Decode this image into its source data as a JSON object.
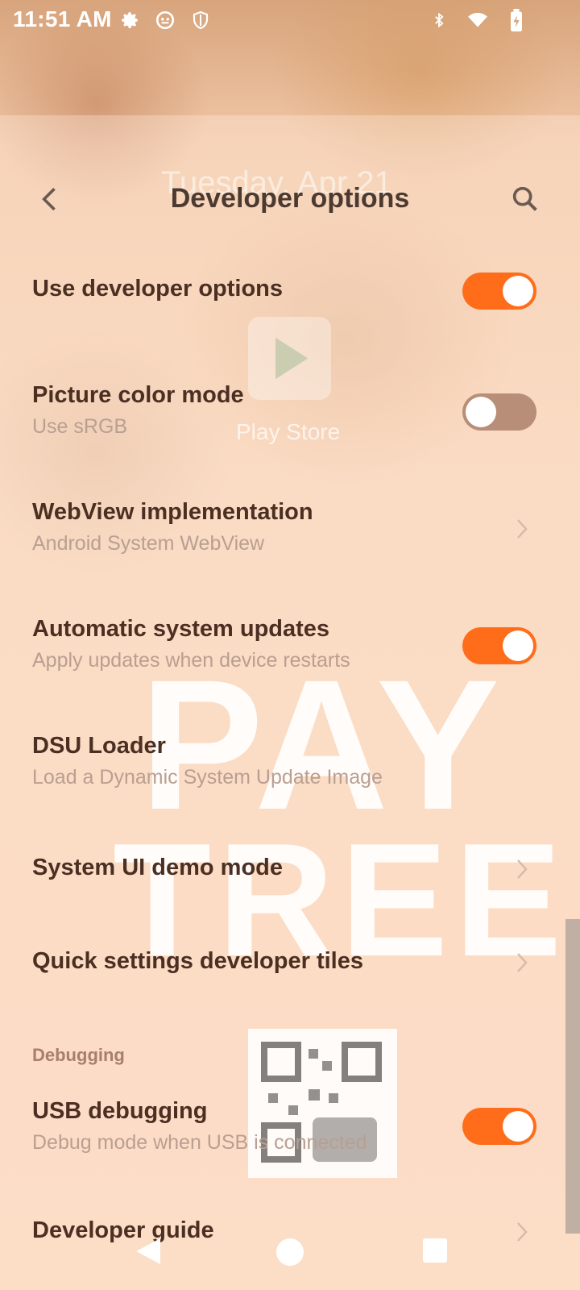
{
  "status_bar": {
    "time": "11:51 AM",
    "left_icons": [
      "gear-icon",
      "face-icon",
      "shield-icon"
    ],
    "right_icons": [
      "bluetooth-icon",
      "wifi-icon",
      "battery-charging-icon"
    ]
  },
  "background": {
    "date_text": "Tuesday, Apr 21",
    "app_label": "Play Store",
    "watermark_line1": "PAY",
    "watermark_line2": "TREE"
  },
  "app_bar": {
    "title": "Developer options",
    "back_icon": "arrow-back-icon",
    "search_icon": "search-icon"
  },
  "settings": {
    "use_dev_options": {
      "title": "Use developer options",
      "enabled": true
    },
    "picture_color_mode": {
      "title": "Picture color mode",
      "subtitle": "Use sRGB",
      "enabled": false
    },
    "webview": {
      "title": "WebView implementation",
      "subtitle": "Android System WebView"
    },
    "auto_updates": {
      "title": "Automatic system updates",
      "subtitle": "Apply updates when device restarts",
      "enabled": true
    },
    "dsu_loader": {
      "title": "DSU Loader",
      "subtitle": "Load a Dynamic System Update Image"
    },
    "demo_mode": {
      "title": "System UI demo mode"
    },
    "qs_tiles": {
      "title": "Quick settings developer tiles"
    },
    "debugging_header": "Debugging",
    "usb_debugging": {
      "title": "USB debugging",
      "subtitle": "Debug mode when USB is connected",
      "enabled": true
    },
    "developer_guide": {
      "title": "Developer guide"
    }
  },
  "colors": {
    "accent": "#ff6d1b",
    "toggle_off": "#b98e78",
    "title_text": "#4b2f23",
    "subtitle_text": "#b99f92"
  },
  "nav_bar": {
    "back_icon": "nav-back-icon",
    "home_icon": "nav-home-icon",
    "recents_icon": "nav-recents-icon"
  }
}
